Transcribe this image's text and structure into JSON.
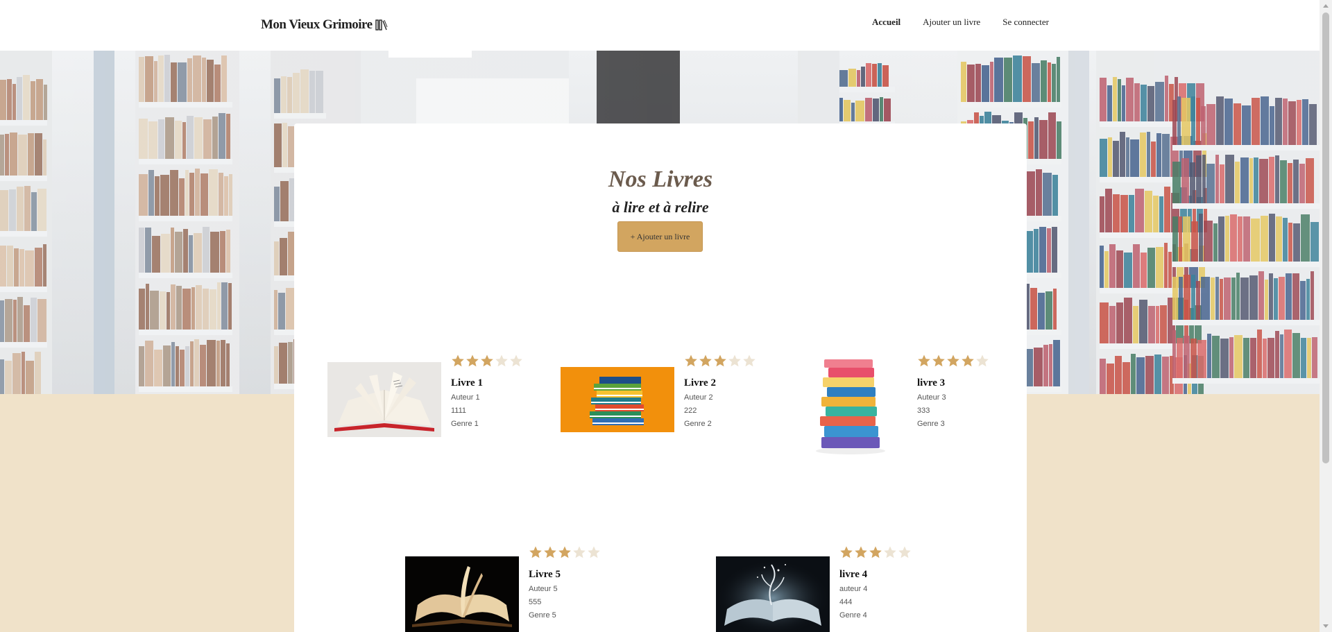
{
  "header": {
    "logo_text": "Mon Vieux Grimoire",
    "nav": [
      {
        "label": "Accueil",
        "active": true
      },
      {
        "label": "Ajouter un livre",
        "active": false
      },
      {
        "label": "Se connecter",
        "active": false
      }
    ]
  },
  "main": {
    "title": "Nos Livres",
    "subtitle": "à lire et à relire",
    "add_button": "+ Ajouter un livre"
  },
  "books": [
    {
      "title": "Livre 1",
      "author": "Auteur 1",
      "year": "1111",
      "genre": "Genre 1",
      "rating": 3,
      "image": "open-book-red-cover"
    },
    {
      "title": "Livre 2",
      "author": "Auteur 2",
      "year": "222",
      "genre": "Genre 2",
      "rating": 3,
      "image": "book-stack-orange"
    },
    {
      "title": "livre 3",
      "author": "Auteur 3",
      "year": "333",
      "genre": "Genre 3",
      "rating": 4,
      "image": "tall-book-stack"
    },
    {
      "title": "Livre 5",
      "author": "Auteur 5",
      "year": "555",
      "genre": "Genre 5",
      "rating": 3,
      "image": "open-book-dark"
    },
    {
      "title": "livre 4",
      "author": "auteur 4",
      "year": "444",
      "genre": "Genre 4",
      "rating": 3,
      "image": "magic-open-book"
    }
  ],
  "colors": {
    "accent": "#d2a560",
    "star_filled": "#d2a560",
    "star_empty": "#ece3d3",
    "page_background": "#f0e2c9"
  }
}
